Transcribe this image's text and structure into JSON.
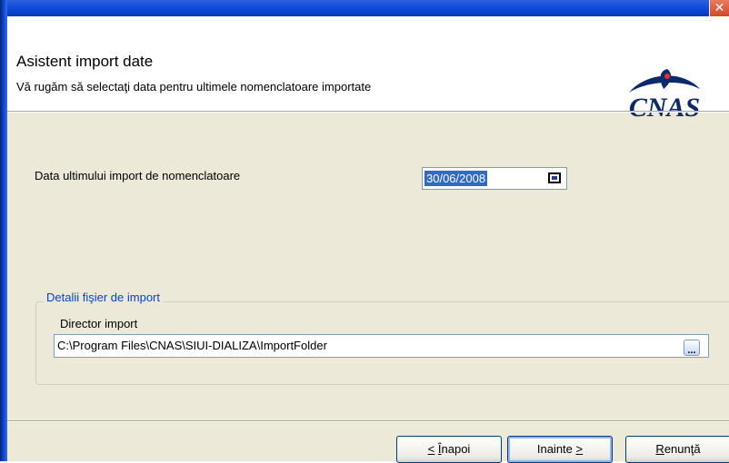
{
  "window": {
    "close_glyph": "✕"
  },
  "header": {
    "title": "Asistent import date",
    "subtitle": "Vă rugăm să selectaţi data pentru ultimele nomenclatoare importate",
    "logo_text": "CNAS",
    "logo_color": "#0b2a6b"
  },
  "form": {
    "date_label": "Data ultimului import de nomenclatoare",
    "date_value": "30/06/2008",
    "date_button_icon": "calendar-icon"
  },
  "import_group": {
    "legend": "Detalii fişier de import",
    "dir_label": "Director import",
    "dir_value": "C:\\Program Files\\CNAS\\SIUI-DIALIZA\\ImportFolder",
    "browse_label": "..."
  },
  "buttons": {
    "back_mnemonic": "Î",
    "back_rest": "napoi",
    "back_prefix": "<",
    "next_label": "Inainte",
    "next_suffix": ">",
    "cancel_mnemonic": "R",
    "cancel_rest": "enunţă"
  }
}
